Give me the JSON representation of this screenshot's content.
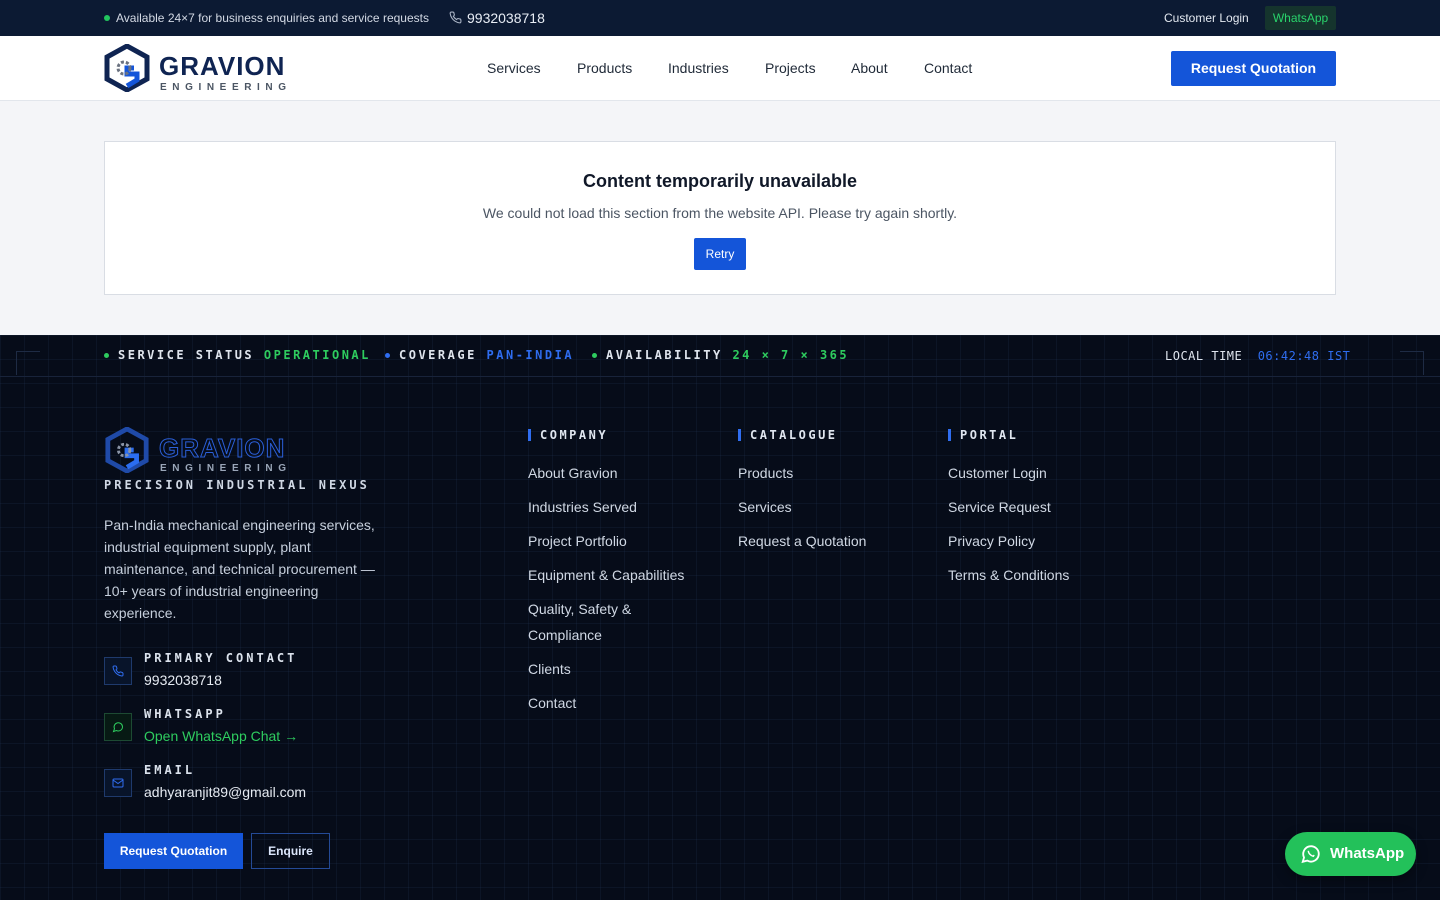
{
  "topbar": {
    "availability": "Available 24×7 for business enquiries and service requests",
    "phone": "9932038718",
    "customer_login": "Customer Login",
    "whatsapp": "WhatsApp"
  },
  "brand": {
    "name": "GRAVION",
    "sub": "ENGINEERING",
    "primary_color": "#1455d9",
    "navy": "#0c1a33"
  },
  "nav": {
    "items": [
      "Services",
      "Products",
      "Industries",
      "Projects",
      "About",
      "Contact"
    ],
    "cta": "Request Quotation"
  },
  "error_card": {
    "title": "Content temporarily unavailable",
    "message": "We could not load this section from the website API. Please try again shortly.",
    "retry": "Retry"
  },
  "footer": {
    "status": {
      "service_label": "SERVICE STATUS",
      "service_value": "OPERATIONAL",
      "coverage_label": "COVERAGE",
      "coverage_value": "PAN-INDIA",
      "availability_label": "AVAILABILITY",
      "availability_value": "24 × 7 × 365",
      "local_time_label": "LOCAL TIME",
      "local_time_value": "06:42:48 IST"
    },
    "tagline": "PRECISION INDUSTRIAL NEXUS",
    "description": "Pan-India mechanical engineering services, industrial equipment supply, plant maintenance, and technical procurement — 10+ years of industrial engineering experience.",
    "contacts": {
      "primary_label": "PRIMARY CONTACT",
      "primary_value": "9932038718",
      "whatsapp_label": "WHATSAPP",
      "whatsapp_value": "Open WhatsApp Chat →",
      "email_label": "EMAIL",
      "email_value": "adhyaranjit89@gmail.com"
    },
    "buttons": {
      "quote": "Request Quotation",
      "enquire": "Enquire"
    },
    "company": {
      "heading": "COMPANY",
      "links": [
        "About Gravion",
        "Industries Served",
        "Project Portfolio",
        "Equipment & Capabilities",
        "Quality, Safety &",
        "Compliance",
        "Clients",
        "Contact"
      ]
    },
    "catalogue": {
      "heading": "CATALOGUE",
      "links": [
        "Products",
        "Services",
        "Request a Quotation"
      ]
    },
    "portal": {
      "heading": "PORTAL",
      "links": [
        "Customer Login",
        "Service Request",
        "Privacy Policy",
        "Terms & Conditions"
      ]
    }
  },
  "floating_whatsapp": "WhatsApp"
}
